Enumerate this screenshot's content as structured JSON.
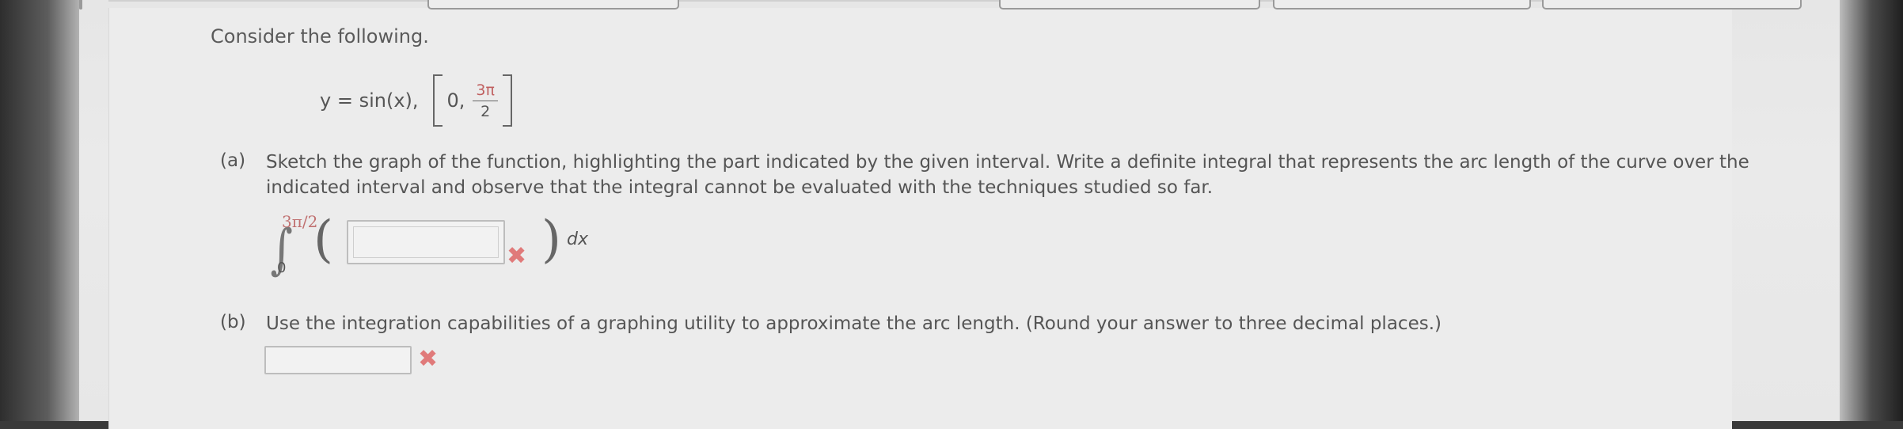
{
  "intro": "Consider the following.",
  "equation": {
    "function": "y = sin(x),",
    "interval_start": "0,",
    "interval_end_num": "3π",
    "interval_end_den": "2"
  },
  "part_a": {
    "label": "(a)",
    "text": "Sketch the graph of the function, highlighting the part indicated by the given interval. Write a definite integral that represents the arc length of the curve over the indicated interval and observe that the integral cannot be evaluated with the techniques studied so far.",
    "upper_limit": "3π/2",
    "lower_limit": "0",
    "integrand_value": "",
    "differential": "dx",
    "status_icon": "x-mark",
    "status_color": "#e07a7a"
  },
  "part_b": {
    "label": "(b)",
    "text": "Use the integration capabilities of a graphing utility to approximate the arc length. (Round your answer to three decimal places.)",
    "answer_value": "",
    "status_icon": "x-mark",
    "status_color": "#e07a7a"
  },
  "icons": {
    "x_mark_glyph": "✖"
  }
}
